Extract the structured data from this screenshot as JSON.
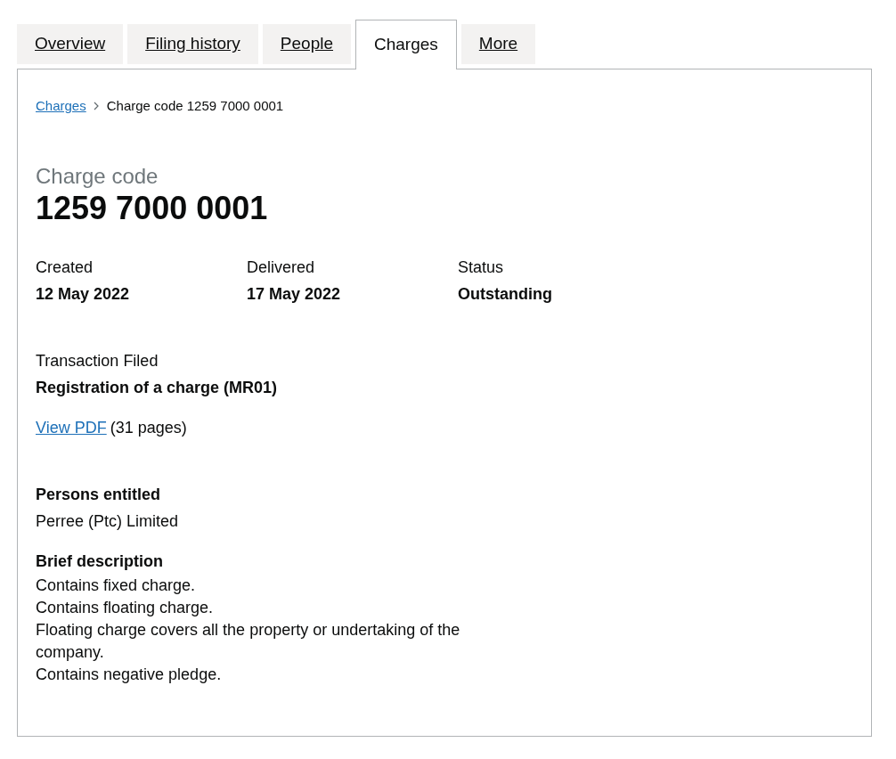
{
  "tabs": [
    {
      "label": "Overview",
      "selected": false
    },
    {
      "label": "Filing history",
      "selected": false
    },
    {
      "label": "People",
      "selected": false
    },
    {
      "label": "Charges",
      "selected": true
    },
    {
      "label": "More",
      "selected": false
    }
  ],
  "breadcrumb": {
    "link": "Charges",
    "current": "Charge code 1259 7000 0001"
  },
  "heading": {
    "caption": "Charge code",
    "title": "1259 7000 0001"
  },
  "summary": [
    {
      "label": "Created",
      "value": "12 May 2022"
    },
    {
      "label": "Delivered",
      "value": "17 May 2022"
    },
    {
      "label": "Status",
      "value": "Outstanding"
    }
  ],
  "transaction": {
    "label": "Transaction Filed",
    "value": "Registration of a charge (MR01)",
    "link": "View PDF",
    "note": "(31 pages)"
  },
  "persons_entitled": {
    "heading": "Persons entitled",
    "value": "Perree (Ptc) Limited"
  },
  "brief_description": {
    "heading": "Brief description",
    "lines": [
      "Contains fixed charge.",
      "Contains floating charge.",
      "Floating charge covers all the property or undertaking of the company.",
      "Contains negative pledge."
    ]
  }
}
